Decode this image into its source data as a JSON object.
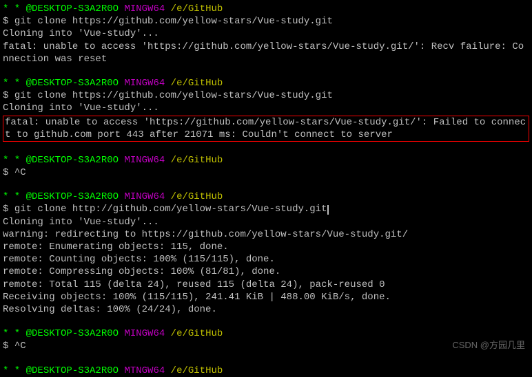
{
  "prompt": {
    "star": "* *",
    "user": " @DESKTOP-S3A2R0O",
    "sys": " MINGW64",
    "path": " /e/GitHub",
    "dollar": "$ "
  },
  "block1": {
    "cmd": "git clone https://github.com/yellow-stars/Vue-study.git",
    "out1": "Cloning into 'Vue-study'...",
    "out2": "fatal: unable to access 'https://github.com/yellow-stars/Vue-study.git/': Recv failure: Connection was reset"
  },
  "block2": {
    "cmd": "git clone https://github.com/yellow-stars/Vue-study.git",
    "out1": "Cloning into 'Vue-study'...",
    "err": "fatal: unable to access 'https://github.com/yellow-stars/Vue-study.git/': Failed to connect to github.com port 443 after 21071 ms: Couldn't connect to server"
  },
  "block3": {
    "cmd": "^C"
  },
  "block4": {
    "cmd": "git clone http://github.com/yellow-stars/Vue-study.git",
    "out1": "Cloning into 'Vue-study'...",
    "out2": "warning: redirecting to https://github.com/yellow-stars/Vue-study.git/",
    "out3": "remote: Enumerating objects: 115, done.",
    "out4": "remote: Counting objects: 100% (115/115), done.",
    "out5": "remote: Compressing objects: 100% (81/81), done.",
    "out6": "remote: Total 115 (delta 24), reused 115 (delta 24), pack-reused 0",
    "out7": "Receiving objects: 100% (115/115), 241.41 KiB | 488.00 KiB/s, done.",
    "out8": "Resolving deltas: 100% (24/24), done."
  },
  "block5": {
    "cmd": "^C"
  },
  "prompt6": {
    "sys_partial": " MTNGW64"
  },
  "watermark": "CSDN @方园几里"
}
